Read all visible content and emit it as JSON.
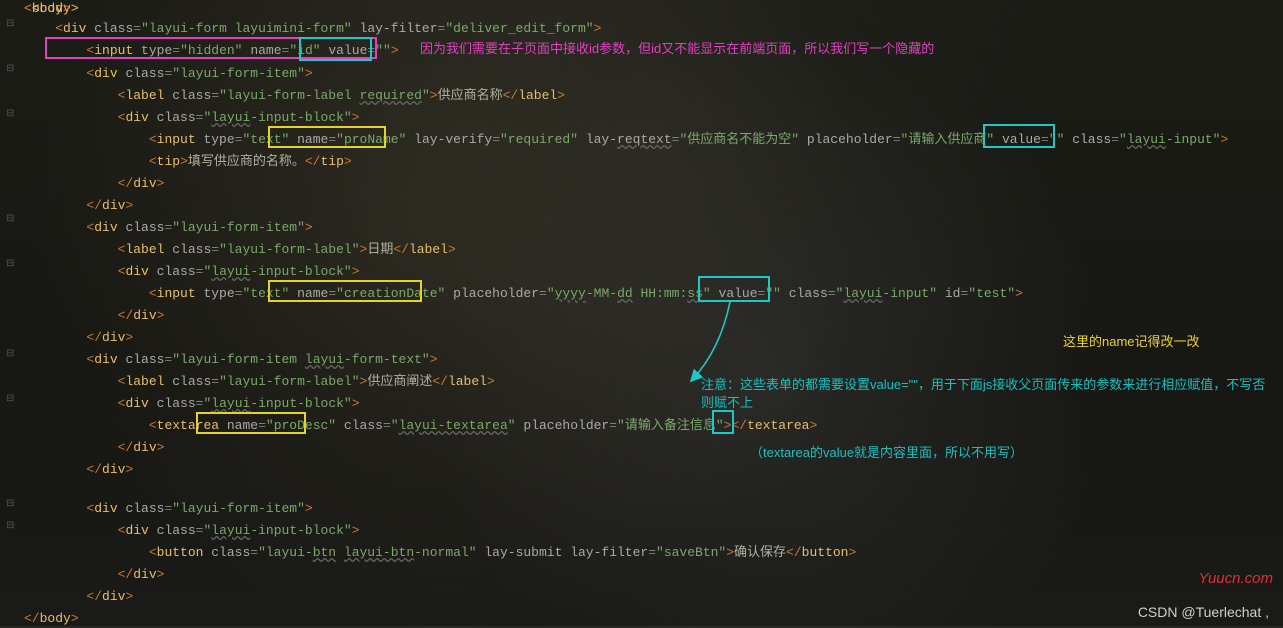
{
  "gutter": {
    "collapse": [
      "⊟",
      "⊟",
      "⊟",
      "⊟",
      "⊟",
      "⊟",
      "⊟",
      "⊟",
      "⊟",
      "⊟",
      "⊟",
      "⊟",
      "⊟"
    ]
  },
  "code": {
    "body_open": "<body>",
    "div_form": {
      "div": "div",
      "cls_attr": "class",
      "cls_val": "layui-form layuimini-form",
      "lf_attr": "lay-filter",
      "lf_val": "deliver_edit_form"
    },
    "hidden": {
      "input": "input",
      "type_attr": "type",
      "type_val": "hidden",
      "name_attr": "name",
      "name_val": "id",
      "value_attr": "value",
      "value_val": ""
    },
    "item1": {
      "div": "div",
      "cls": "layui-form-item",
      "label": {
        "tag": "label",
        "cls": "layui-form-label required",
        "text": "供应商名称"
      },
      "block": {
        "tag": "div",
        "cls": "layui-input-block"
      },
      "input": {
        "tag": "input",
        "type": "text",
        "name": "proName",
        "lv": "lay-verify",
        "lv_v": "required",
        "lr": "lay-reqtext",
        "lr_v": "供应商名不能为空",
        "ph": "placeholder",
        "ph_v": "请输入供应商",
        "value": "",
        "cls": "layui-input"
      },
      "tip": {
        "tag": "tip",
        "text": "填写供应商的名称。"
      }
    },
    "item2": {
      "div": "div",
      "cls": "layui-form-item",
      "label": {
        "tag": "label",
        "cls": "layui-form-label",
        "text": "日期"
      },
      "block": {
        "tag": "div",
        "cls": "layui-input-block"
      },
      "input": {
        "tag": "input",
        "type": "text",
        "name": "creationDate",
        "ph": "placeholder",
        "ph_v": "yyyy-MM-dd HH:mm:ss",
        "value": "",
        "cls": "layui-input",
        "id": "test"
      }
    },
    "item3": {
      "div": "div",
      "cls": "layui-form-item layui-form-text",
      "label": {
        "tag": "label",
        "cls": "layui-form-label",
        "text": "供应商阐述"
      },
      "block": {
        "tag": "div",
        "cls": "layui-input-block"
      },
      "ta": {
        "tag": "textarea",
        "name": "proDesc",
        "cls": "layui-textarea",
        "ph": "placeholder",
        "ph_v": "请输入备注信息"
      }
    },
    "item4": {
      "div": "div",
      "cls": "layui-form-item",
      "block": {
        "tag": "div",
        "cls": "layui-input-block"
      },
      "btn": {
        "tag": "button",
        "cls": "layui-btn layui-btn-normal",
        "ls": "lay-submit",
        "lf": "lay-filter",
        "lf_v": "saveBtn",
        "text": "确认保存"
      }
    },
    "close": {
      "div": "</div>",
      "body": "</body>"
    }
  },
  "annotations": {
    "a1": "因为我们需要在子页面中接收id参数，但id又不能显示在前端页面，所以我们写一个隐藏的",
    "a2": "这里的name记得改一改",
    "a3": "注意：这些表单的都需要设置value=\"\"，用于下面js接收父页面传来的参数来进行相应赋值，不写否则赋不上",
    "a4": "（textarea的value就是内容里面，所以不用写）"
  },
  "watermark": {
    "site": "Yuucn.com",
    "csdn": "CSDN @Tuerlechat ,"
  }
}
